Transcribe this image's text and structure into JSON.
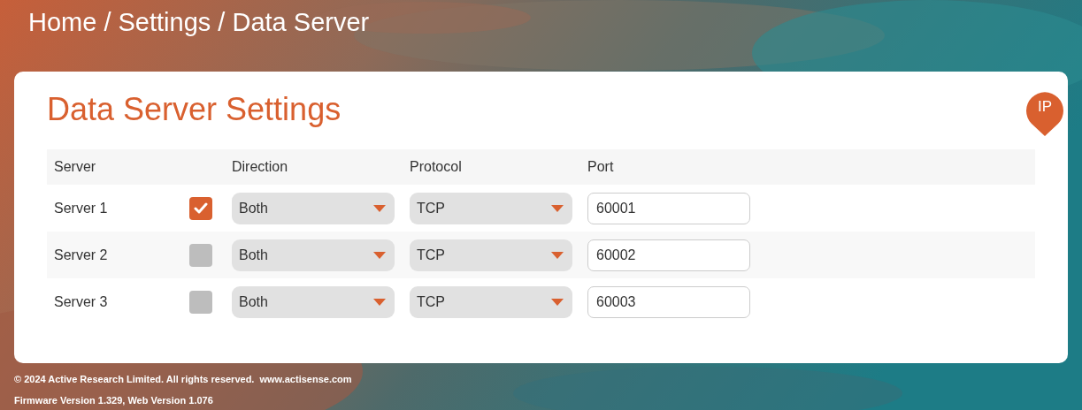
{
  "breadcrumb": "Home / Settings / Data Server",
  "card": {
    "title": "Data Server Settings",
    "badge": "IP"
  },
  "table": {
    "columns": [
      "Server",
      "Direction",
      "Protocol",
      "Port"
    ],
    "rows": [
      {
        "server": "Server 1",
        "enabled": true,
        "direction": "Both",
        "protocol": "TCP",
        "port": "60001"
      },
      {
        "server": "Server 2",
        "enabled": false,
        "direction": "Both",
        "protocol": "TCP",
        "port": "60002"
      },
      {
        "server": "Server 3",
        "enabled": false,
        "direction": "Both",
        "protocol": "TCP",
        "port": "60003"
      }
    ]
  },
  "footer": {
    "copyright": "© 2024 Active Research Limited. All rights reserved.",
    "link": "www.actisense.com",
    "version": "Firmware Version 1.329, Web Version 1.076"
  }
}
